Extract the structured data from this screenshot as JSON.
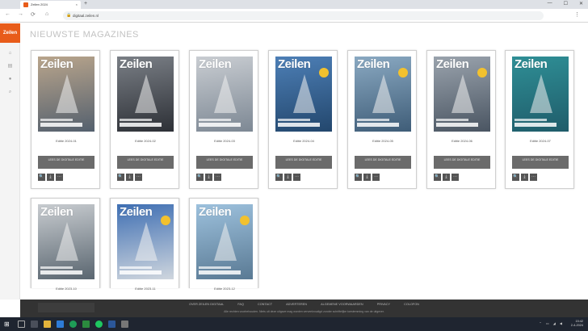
{
  "browser": {
    "tab_title": "Zeilen 2024",
    "tab_close": "×",
    "new_tab": "+",
    "url": "digitaal.zeilen.nl",
    "win_buttons": [
      "—",
      "☐",
      "✕"
    ]
  },
  "sidebar": {
    "logo": "Zeilen"
  },
  "page_title": "NIEUWSTE MAGAZINES",
  "magazines": [
    {
      "brand": "Zeilen",
      "date": "Editie 2024-01",
      "button": "LEES DE DIGITALE EDITIE",
      "colors": [
        "#b9a58c",
        "#54606e"
      ]
    },
    {
      "brand": "Zeilen",
      "date": "Editie 2024-02",
      "button": "LEES DE DIGITALE EDITIE",
      "colors": [
        "#7a7f86",
        "#2d3036"
      ]
    },
    {
      "brand": "Zeilen",
      "date": "Editie 2024-03",
      "button": "LEES DE DIGITALE EDITIE",
      "colors": [
        "#c9cdd2",
        "#7d8894"
      ]
    },
    {
      "brand": "Zeilen",
      "date": "Editie 2024-04",
      "button": "LEES DE DIGITALE EDITIE",
      "colors": [
        "#4d7fb6",
        "#23476d"
      ]
    },
    {
      "brand": "Zeilen",
      "date": "Editie 2024-05",
      "button": "LEES DE DIGITALE EDITIE",
      "colors": [
        "#8aa9c2",
        "#3f5d78"
      ]
    },
    {
      "brand": "Zeilen",
      "date": "Editie 2024-06",
      "button": "LEES DE DIGITALE EDITIE",
      "colors": [
        "#9aa3ad",
        "#4a5562"
      ]
    },
    {
      "brand": "Zeilen",
      "date": "Editie 2024-07",
      "button": "LEES DE DIGITALE EDITIE",
      "colors": [
        "#2f8f96",
        "#1f5c6a"
      ]
    },
    {
      "brand": "Zeilen",
      "date": "Editie 2023-10",
      "button": "",
      "colors": [
        "#c8ccd0",
        "#5a6670"
      ]
    },
    {
      "brand": "Zeilen",
      "date": "Editie 2023-11",
      "button": "",
      "colors": [
        "#3f6fb3",
        "#cfd6de"
      ]
    },
    {
      "brand": "Zeilen",
      "date": "Editie 2023-12",
      "button": "",
      "colors": [
        "#9dc1dd",
        "#5a7a94"
      ]
    }
  ],
  "icon_buttons": [
    "🔍",
    "⤓",
    "⋯"
  ],
  "footer": {
    "links": [
      "OVER ZEILEN DIGITAAL",
      "FAQ",
      "CONTACT",
      "ADVERTEREN",
      "ALGEMENE VOORWAARDEN",
      "PRIVACY",
      "COLOFON"
    ],
    "copy": "Alle rechten voorbehouden. Niets uit deze uitgave mag worden verveelvoudigd zonder schriftelijke toestemming van de uitgever."
  },
  "taskbar": {
    "time": "15:42",
    "date": "2-4-2024",
    "tray": "⌃ ▭ ◢ ◀"
  }
}
